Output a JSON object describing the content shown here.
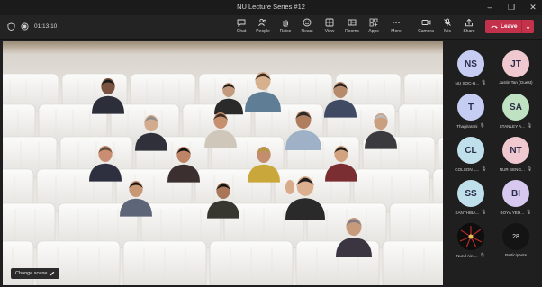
{
  "window": {
    "title": "NU Lecture Series #12"
  },
  "meeting": {
    "elapsed": "01:13:10"
  },
  "toolbar": {
    "items": [
      {
        "label": "Chat",
        "icon": "chat-icon"
      },
      {
        "label": "People",
        "icon": "people-icon"
      },
      {
        "label": "Raise",
        "icon": "raise-hand-icon"
      },
      {
        "label": "React",
        "icon": "react-icon"
      },
      {
        "label": "View",
        "icon": "view-icon"
      },
      {
        "label": "Rooms",
        "icon": "rooms-icon"
      },
      {
        "label": "Apps",
        "icon": "apps-icon"
      },
      {
        "label": "More",
        "icon": "more-icon"
      },
      {
        "label": "Camera",
        "icon": "camera-icon"
      },
      {
        "label": "Mic",
        "icon": "mic-off-icon"
      },
      {
        "label": "Share",
        "icon": "share-icon"
      }
    ],
    "leave_label": "Leave",
    "leave_color": "#c4314b"
  },
  "stage": {
    "change_scene_label": "Change scene"
  },
  "participants_panel": {
    "tiles": [
      {
        "initials": "NS",
        "name": "NU SOC-H...",
        "color": "#c7cdf2",
        "muted": true
      },
      {
        "initials": "JT",
        "name": "Justin Tan (Guest)",
        "color": "#f0c8cf",
        "muted": false
      },
      {
        "initials": "T",
        "name": "Thagirarani",
        "color": "#c6cdf2",
        "muted": true
      },
      {
        "initials": "SA",
        "name": "STANLEY A...",
        "color": "#bfe3c2",
        "muted": true
      },
      {
        "initials": "CL",
        "name": "COLSON L...",
        "color": "#bfe0ea",
        "muted": true
      },
      {
        "initials": "NT",
        "name": "NUR SENG...",
        "color": "#f0c8cf",
        "muted": true
      },
      {
        "initials": "SS",
        "name": "SANTHIBA...",
        "color": "#bfe0ea",
        "muted": true
      },
      {
        "initials": "BI",
        "name": "BOYA YEH...",
        "color": "#d6c8ee",
        "muted": true
      },
      {
        "initials": "",
        "name": "Nurul Ain ...",
        "color": "#111111",
        "muted": true
      }
    ],
    "participants_count": "28",
    "participants_label": "Participants"
  }
}
